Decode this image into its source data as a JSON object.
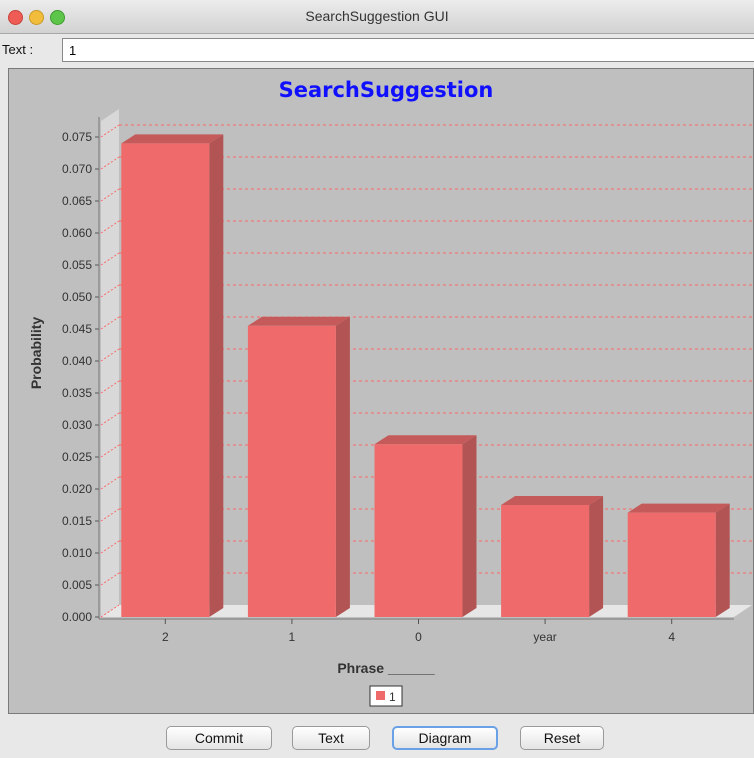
{
  "window": {
    "title": "SearchSuggestion GUI"
  },
  "textfield": {
    "label": "Text :",
    "value": "1"
  },
  "buttons": {
    "commit": "Commit",
    "text": "Text",
    "diagram": "Diagram",
    "reset": "Reset"
  },
  "colors": {
    "title": "#1010ff",
    "bar": "#ef6b6b",
    "bar_top": "#c55a5a",
    "bar_side": "#b35454",
    "grid": "#ff6666"
  },
  "chart_data": {
    "type": "bar",
    "title": "SearchSuggestion",
    "xlabel": "Phrase ______",
    "ylabel": "Probability",
    "categories": [
      "2",
      "1",
      "0",
      "year",
      "4"
    ],
    "series": [
      {
        "name": "1",
        "values": [
          0.074,
          0.0455,
          0.027,
          0.0175,
          0.0163
        ]
      }
    ],
    "ylim": [
      0,
      0.0775
    ],
    "yticks": [
      "0.000",
      "0.005",
      "0.010",
      "0.015",
      "0.020",
      "0.025",
      "0.030",
      "0.035",
      "0.040",
      "0.045",
      "0.050",
      "0.055",
      "0.060",
      "0.065",
      "0.070",
      "0.075"
    ],
    "grid": true,
    "legend": "bottom-center"
  }
}
